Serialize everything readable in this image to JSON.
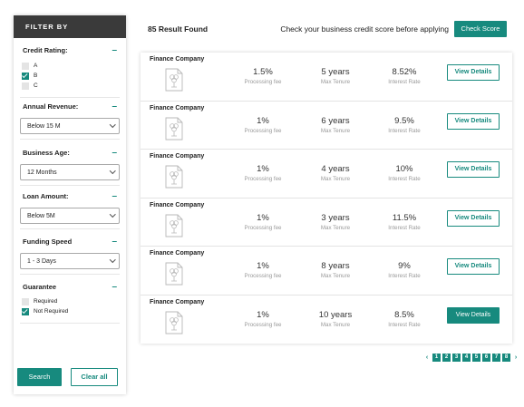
{
  "sidebar": {
    "header": "FILTER BY",
    "credit_rating": {
      "title": "Credit Rating:",
      "options": [
        {
          "label": "A",
          "checked": false
        },
        {
          "label": "B",
          "checked": true
        },
        {
          "label": "C",
          "checked": false
        }
      ]
    },
    "annual_revenue": {
      "title": "Annual Revenue:",
      "value": "Below 15 M"
    },
    "business_age": {
      "title": "Business Age:",
      "value": "12 Months"
    },
    "loan_amount": {
      "title": "Loan Amount:",
      "value": "Below 5M"
    },
    "funding_speed": {
      "title": "Funding Speed",
      "value": "1 - 3 Days"
    },
    "guarantee": {
      "title": "Guarantee",
      "options": [
        {
          "label": "Required",
          "checked": false
        },
        {
          "label": "Not Required",
          "checked": true
        }
      ]
    },
    "search_label": "Search",
    "clear_label": "Clear all"
  },
  "topbar": {
    "result_count": "85 Result Found",
    "check_text": "Check your business credit score before applying",
    "check_button": "Check Score"
  },
  "results": [
    {
      "company": "Finance Company",
      "fee": "1.5%",
      "fee_label": "Processing fee",
      "tenure": "5 years",
      "tenure_label": "Max Tenure",
      "rate": "8.52%",
      "rate_label": "Interest Rate",
      "button": "View Details"
    },
    {
      "company": "Finance Company",
      "fee": "1%",
      "fee_label": "Processing fee",
      "tenure": "6 years",
      "tenure_label": "Max Tenure",
      "rate": "9.5%",
      "rate_label": "Interest Rate",
      "button": "View Details"
    },
    {
      "company": "Finance Company",
      "fee": "1%",
      "fee_label": "Processing fee",
      "tenure": "4 years",
      "tenure_label": "Max Tenure",
      "rate": "10%",
      "rate_label": "Interest Rate",
      "button": "View Details"
    },
    {
      "company": "Finance Company",
      "fee": "1%",
      "fee_label": "Processing fee",
      "tenure": "3 years",
      "tenure_label": "Max Tenure",
      "rate": "11.5%",
      "rate_label": "Interest Rate",
      "button": "View Details"
    },
    {
      "company": "Finance Company",
      "fee": "1%",
      "fee_label": "Processing fee",
      "tenure": "8 years",
      "tenure_label": "Max Tenure",
      "rate": "9%",
      "rate_label": "Interest Rate",
      "button": "View Details"
    },
    {
      "company": "Finance Company",
      "fee": "1%",
      "fee_label": "Processing fee",
      "tenure": "10 years",
      "tenure_label": "Max Tenure",
      "rate": "8.5%",
      "rate_label": "Interest Rate",
      "button": "View Details"
    }
  ],
  "pagination": {
    "prev": "‹",
    "pages": [
      "1",
      "2",
      "3",
      "4",
      "5",
      "6",
      "7",
      "8"
    ],
    "next": "›"
  },
  "colors": {
    "accent": "#178a7e",
    "header_bg": "#3a3a3a"
  }
}
